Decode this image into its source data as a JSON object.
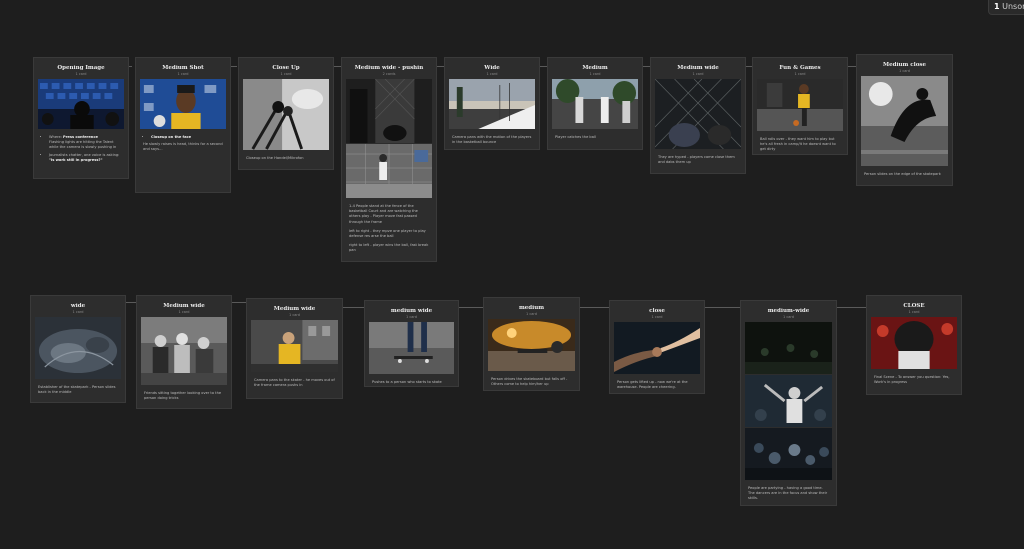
{
  "badge": {
    "count": "1",
    "label": "Unsorted"
  },
  "row1": [
    {
      "title": "Opening Image",
      "sub": "1 card",
      "lines": [
        "Where: ",
        "Press conference",
        "Flashing lights are hitting the Talent while the camera is slowly pushing in",
        "Journalists chatter, one voice is asking: ",
        "\"Is work still in progress?\""
      ]
    },
    {
      "title": "Medium Shot",
      "sub": "1 card",
      "lines": [
        "Closeup on the face",
        "He slowly raises is head, thinks for a second and says…"
      ]
    },
    {
      "title": "Close Up",
      "sub": "1 card",
      "lines": [
        "Closeup on the Handel/Mikrofon"
      ]
    },
    {
      "title": "Medium wide - pushin",
      "sub": "2 cards",
      "lines": [
        "1-4 People stand at the fence of the basketball Court and are watching the others play - Player move fast passed through the frame",
        "left to right - they mpve one player to play defense res arse the ball",
        "right to left - player wins the ball, fast break pan"
      ]
    },
    {
      "title": "Wide",
      "sub": "1 card",
      "lines": [
        "Camera pans with the motion of the players in the basketball bounce"
      ]
    },
    {
      "title": "Medium",
      "sub": "1 card",
      "lines": [
        "Player catches the ball"
      ]
    },
    {
      "title": "Medium wide",
      "sub": "1 card",
      "lines": [
        "They are hyped - players come close them and dabs them up"
      ]
    },
    {
      "title": "Fun & Games",
      "sub": "1 card",
      "lines": [
        "Ball rolls over - they want him to play but he's all fresh in camp/it he doesnt want to get dirty"
      ]
    },
    {
      "title": "Medium close",
      "sub": "1 card",
      "lines": [
        "Person slides on the edge of the skatepark"
      ]
    }
  ],
  "row2": [
    {
      "title": "wide",
      "sub": "1 card",
      "lines": [
        "Establisher of the skatepark - Person slides back in the middle"
      ]
    },
    {
      "title": "Medium wide",
      "sub": "1 card",
      "lines": [
        "Friends sitting together looking over to the person doing tricks"
      ]
    },
    {
      "title": "Medium wide",
      "sub": "1 card",
      "lines": [
        "Camera pans to the skater - he moves out of the frame camera pushs in"
      ]
    },
    {
      "title": "medium wide",
      "sub": "1 card",
      "lines": [
        "Pushes to a person who starts to skate"
      ]
    },
    {
      "title": "medium",
      "sub": "1 card",
      "lines": [
        "Person drives the skateboard but falls off - Others come to help him/her up"
      ]
    },
    {
      "title": "close",
      "sub": "1 card",
      "lines": [
        "Person gets lifted up - now we're at the warehouse. People are cheering."
      ]
    },
    {
      "title": "medium-wide",
      "sub": "1 card",
      "lines": [
        "People are partying - having a good time. The dancers are in the focus and show their skills."
      ]
    },
    {
      "title": "CLOSE",
      "sub": "1 card",
      "lines": [
        "Final Scene - To answer you question: Yes, Work's in progress"
      ]
    }
  ]
}
